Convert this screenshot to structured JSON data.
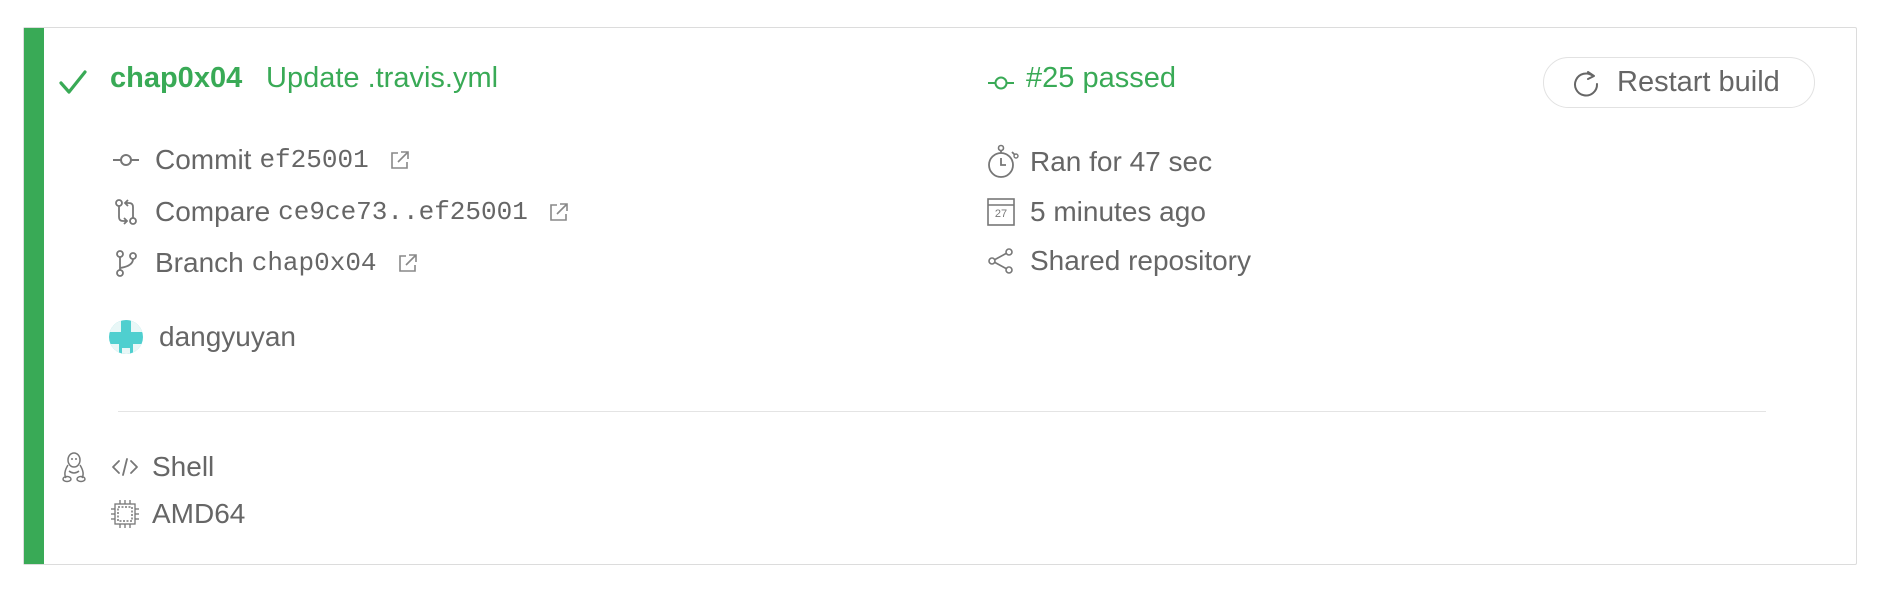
{
  "build": {
    "branch": "chap0x04",
    "commit_message": "Update .travis.yml",
    "status": "#25 passed",
    "restart_label": "Restart build"
  },
  "details": {
    "commit_label": "Commit",
    "commit_sha": "ef25001",
    "compare_label": "Compare",
    "compare_range": "ce9ce73..ef25001",
    "branch_label": "Branch",
    "branch_name": "chap0x04",
    "duration": "Ran for 47 sec",
    "calendar_day": "27",
    "finished": "5 minutes ago",
    "repo_visibility": "Shared repository",
    "author": "dangyuyan"
  },
  "job": {
    "language": "Shell",
    "arch": "AMD64"
  },
  "colors": {
    "passed": "#39aa56",
    "text": "#666666",
    "border": "#dcdcdc"
  },
  "icons": {
    "status": "check-icon",
    "build": "commit-icon",
    "restart": "restart-icon",
    "commit": "commit-icon",
    "compare": "compare-icon",
    "branch": "branch-icon",
    "external": "external-link-icon",
    "duration": "stopwatch-icon",
    "date": "calendar-icon",
    "shared": "share-icon",
    "os": "linux-icon",
    "language": "code-icon",
    "arch": "cpu-icon"
  }
}
